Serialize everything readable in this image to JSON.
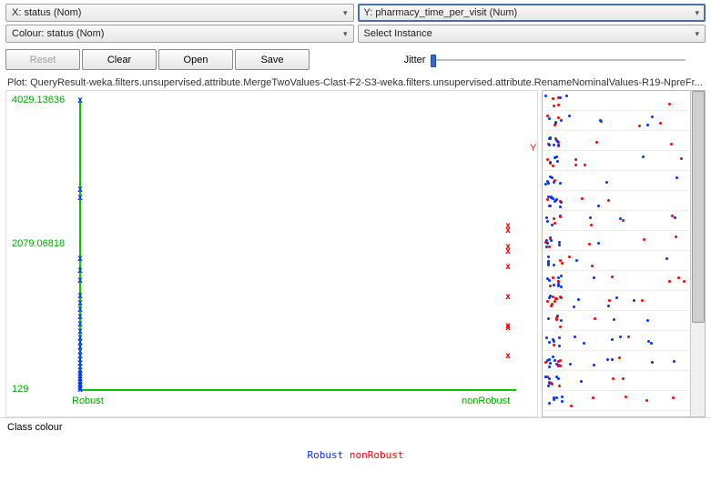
{
  "controls": {
    "x_combo": "X: status (Nom)",
    "y_combo": "Y: pharmacy_time_per_visit (Num)",
    "colour_combo": "Colour: status (Nom)",
    "instance_combo": "Select Instance",
    "reset": "Reset",
    "clear": "Clear",
    "open": "Open",
    "save": "Save",
    "jitter_label": "Jitter"
  },
  "plot_title": "Plot: QueryResult-weka.filters.unsupervised.attribute.MergeTwoValues-Clast-F2-S3-weka.filters.unsupervised.attribute.RenameNominalValues-R19-NpreFr...",
  "axes": {
    "y_max": "4029.13636",
    "y_mid": "2079.06818",
    "y_min": "129",
    "x_cat1": "Robust",
    "x_cat2": "nonRobust"
  },
  "side_label": "Y",
  "class_colour_label": "Class colour",
  "legend": {
    "robust": "Robust",
    "nonrobust": "nonRobust"
  },
  "chart_data": {
    "type": "scatter",
    "title": "QueryResult pharmacy_time_per_visit by status",
    "xlabel": "status",
    "ylabel": "pharmacy_time_per_visit",
    "x_type": "nominal",
    "categories": [
      "Robust",
      "nonRobust"
    ],
    "ylim": [
      129,
      4029.13636
    ],
    "colour_by": "status",
    "colours": {
      "Robust": "#0033ff",
      "nonRobust": "#ff0000"
    },
    "series": [
      {
        "name": "Robust",
        "x": "Robust",
        "y": [
          4029,
          2800,
          2700,
          1850,
          1700,
          1550,
          1350,
          1250,
          1150,
          1050,
          950,
          850,
          750,
          700,
          650,
          600,
          550,
          500,
          450,
          400,
          350,
          320,
          300,
          280,
          260,
          240,
          220,
          200,
          180,
          160,
          150,
          140,
          135,
          130,
          129
        ]
      },
      {
        "name": "nonRobust",
        "x": "nonRobust",
        "y": [
          2350,
          2280,
          2080,
          2040,
          1820,
          1350,
          1320,
          1000,
          970
        ]
      }
    ]
  }
}
